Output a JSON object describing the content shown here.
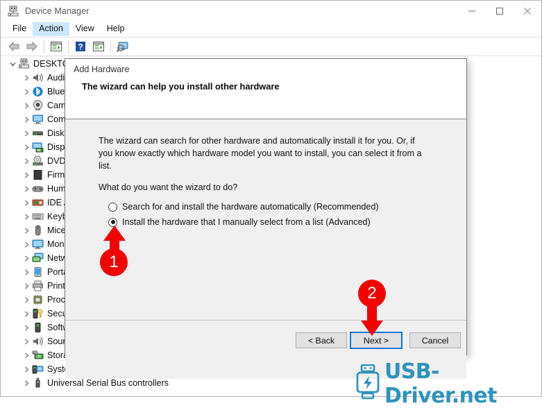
{
  "window": {
    "title": "Device Manager",
    "icon": "device-manager-icon",
    "controls": [
      {
        "name": "minimize-button",
        "glyph": "minimize-icon"
      },
      {
        "name": "maximize-button",
        "glyph": "maximize-icon"
      },
      {
        "name": "close-button",
        "glyph": "close-icon"
      }
    ]
  },
  "menubar": {
    "items": [
      {
        "label": "File",
        "highlighted": false
      },
      {
        "label": "Action",
        "highlighted": true
      },
      {
        "label": "View",
        "highlighted": false
      },
      {
        "label": "Help",
        "highlighted": false
      }
    ]
  },
  "toolbar": {
    "buttons": [
      {
        "name": "back-arrow-icon"
      },
      {
        "name": "forward-arrow-icon"
      },
      {
        "name": "properties-icon"
      },
      {
        "name": "help-icon"
      },
      {
        "name": "show-hidden-devices-icon"
      },
      {
        "name": "scan-hardware-changes-icon"
      }
    ]
  },
  "tree": {
    "root": "DESKTOP",
    "items": [
      {
        "label": "Audio",
        "icon": "speaker-icon"
      },
      {
        "label": "Bluet",
        "icon": "bluetooth-icon"
      },
      {
        "label": "Came",
        "icon": "camera-icon"
      },
      {
        "label": "Comp",
        "icon": "computer-icon"
      },
      {
        "label": "Disk d",
        "icon": "disk-drive-icon"
      },
      {
        "label": "Displa",
        "icon": "display-adapter-icon"
      },
      {
        "label": "DVD/",
        "icon": "dvd-drive-icon"
      },
      {
        "label": "Firmw",
        "icon": "firmware-icon"
      },
      {
        "label": "Hum",
        "icon": "human-interface-icon"
      },
      {
        "label": "IDE A",
        "icon": "ide-controller-icon"
      },
      {
        "label": "Keyb",
        "icon": "keyboard-icon"
      },
      {
        "label": "Mice",
        "icon": "mouse-icon"
      },
      {
        "label": "Moni",
        "icon": "monitor-icon"
      },
      {
        "label": "Netw",
        "icon": "network-adapter-icon"
      },
      {
        "label": "Porta",
        "icon": "portable-device-icon"
      },
      {
        "label": "Print",
        "icon": "printer-icon"
      },
      {
        "label": "Proce",
        "icon": "processor-icon"
      },
      {
        "label": "Secur",
        "icon": "security-device-icon"
      },
      {
        "label": "Softw",
        "icon": "software-device-icon"
      },
      {
        "label": "Soun",
        "icon": "sound-device-icon"
      },
      {
        "label": "Stora",
        "icon": "storage-controller-icon"
      },
      {
        "label": "Syste",
        "icon": "system-device-icon"
      },
      {
        "label": "Universal Serial Bus controllers",
        "icon": "usb-controller-icon"
      }
    ]
  },
  "dialog": {
    "title": "Add Hardware",
    "heading": "The wizard can help you install other hardware",
    "paragraph": "The wizard can search for other hardware and automatically install it for you. Or, if you know exactly which hardware model you want to install, you can select it from a list.",
    "question": "What do you want the wizard to do?",
    "options": [
      {
        "label": "Search for and install the hardware automatically (Recommended)",
        "selected": false
      },
      {
        "label": "Install the hardware that I manually select from a list (Advanced)",
        "selected": true
      }
    ],
    "buttons": {
      "back": "< Back",
      "next": "Next >",
      "cancel": "Cancel"
    }
  },
  "annotations": [
    {
      "name": "step-marker-1",
      "label": "1",
      "direction": "up"
    },
    {
      "name": "step-marker-2",
      "label": "2",
      "direction": "down"
    }
  ],
  "watermark": {
    "text": "USB-Driver.net",
    "color": "#2f93bd",
    "icon": "usb-logo-icon"
  }
}
